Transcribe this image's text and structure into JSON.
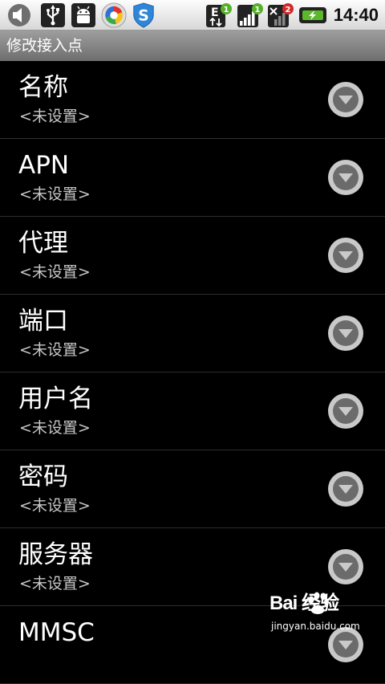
{
  "status_bar": {
    "time": "14:40",
    "icons": [
      "volume-icon",
      "usb-icon",
      "android-debug-icon",
      "browser-icon",
      "shield-s-icon",
      "edge-network-icon",
      "signal-icon",
      "no-signal-icon",
      "battery-charging-icon"
    ],
    "edge_label": "E",
    "badge_edge": "1",
    "badge_signal": "1",
    "badge_nosignal": "2"
  },
  "header": {
    "title": "修改接入点"
  },
  "list": {
    "items": [
      {
        "label": "名称",
        "value": "<未设置>"
      },
      {
        "label": "APN",
        "value": "<未设置>"
      },
      {
        "label": "代理",
        "value": "<未设置>"
      },
      {
        "label": "端口",
        "value": "<未设置>"
      },
      {
        "label": "用户名",
        "value": "<未设置>"
      },
      {
        "label": "密码",
        "value": "<未设置>"
      },
      {
        "label": "服务器",
        "value": "<未设置>"
      },
      {
        "label": "MMSC",
        "value": ""
      }
    ]
  },
  "watermark": {
    "brand": "Bai 经验",
    "url": "jingyan.baidu.com"
  },
  "colors": {
    "background": "#000000",
    "status_bar": "#e8e8e8",
    "title_bar": "#8a8a8a",
    "row_text": "#ffffff",
    "row_subtext": "#c8c8c8",
    "battery_green": "#5cb82a"
  }
}
